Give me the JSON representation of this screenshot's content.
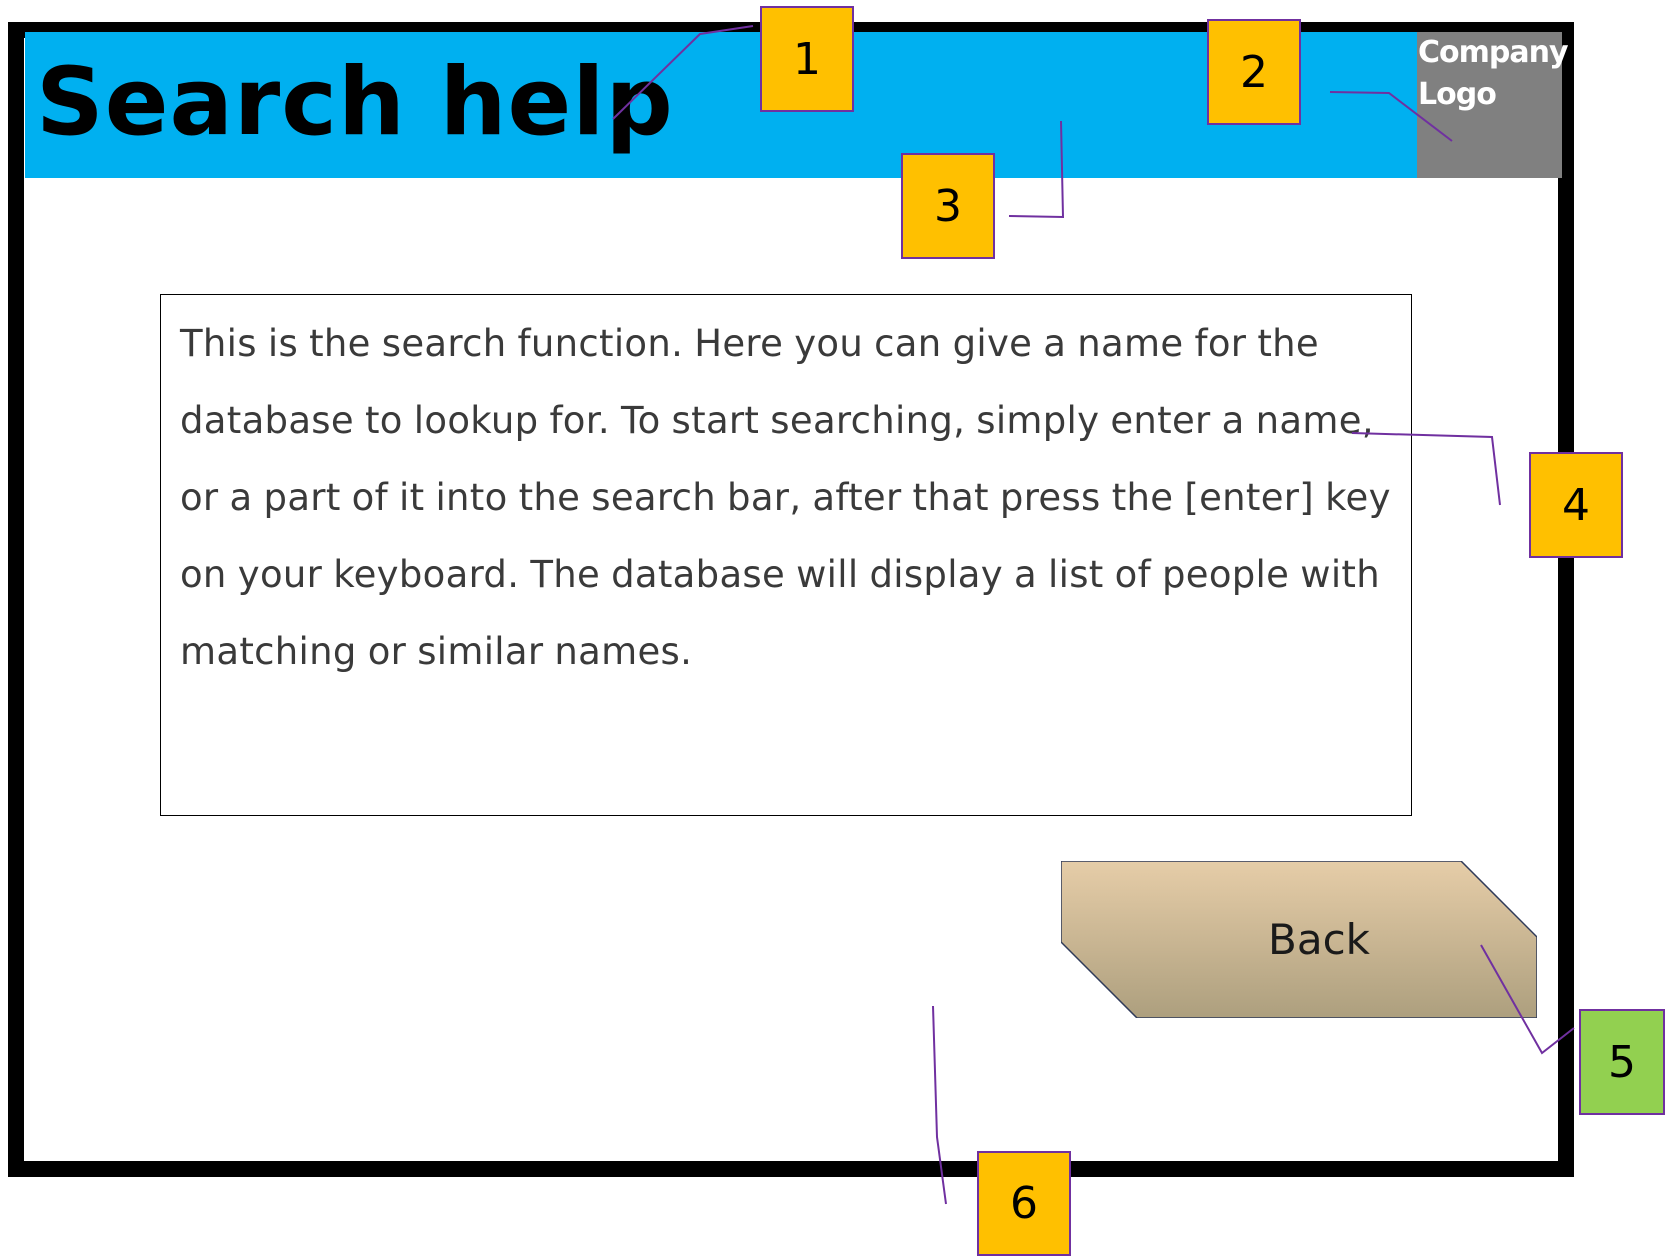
{
  "page": {
    "title": "Search help",
    "logo": {
      "line1": "Company",
      "line2": "Logo"
    },
    "help_text": "This is the search function. Here you can give a name for the database to lookup for. To start searching, simply enter a name, or a part of it into the search bar, after that press the [enter] key on your keyboard. The database will display a list of people with matching or similar names.",
    "back_button": "Back"
  },
  "annotations": [
    {
      "label": "1",
      "color": "#ffc000"
    },
    {
      "label": "2",
      "color": "#ffc000"
    },
    {
      "label": "3",
      "color": "#ffc000"
    },
    {
      "label": "4",
      "color": "#ffc000"
    },
    {
      "label": "5",
      "color": "#92d050"
    },
    {
      "label": "6",
      "color": "#ffc000"
    }
  ],
  "colors": {
    "header": "#00b0f0",
    "logo_background": "#808080",
    "frame": "#000000",
    "callout_border": "#7030a0",
    "leader_line": "#7030a0",
    "button_gradient_top": "#e6cda8",
    "button_gradient_bottom": "#ad9f7e"
  }
}
